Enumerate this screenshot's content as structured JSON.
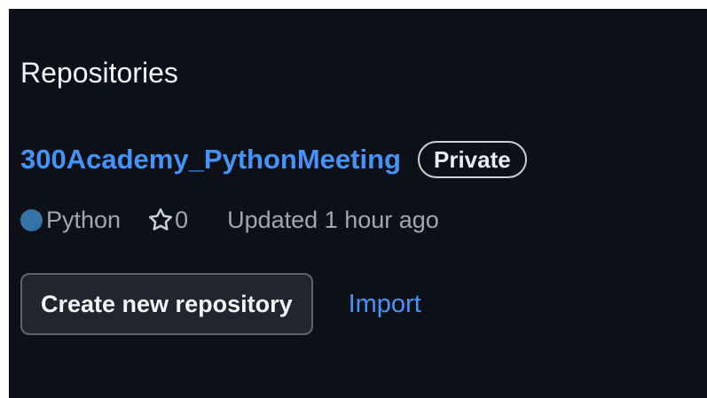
{
  "section": {
    "title": "Repositories"
  },
  "repository": {
    "name": "300Academy_PythonMeeting",
    "visibility": "Private",
    "language": "Python",
    "language_color": "#3572A5",
    "stars": "0",
    "updated": "Updated 1 hour ago"
  },
  "actions": {
    "create_label": "Create new repository",
    "import_label": "Import"
  },
  "colors": {
    "background": "#0d1117",
    "link": "#4493f8"
  }
}
